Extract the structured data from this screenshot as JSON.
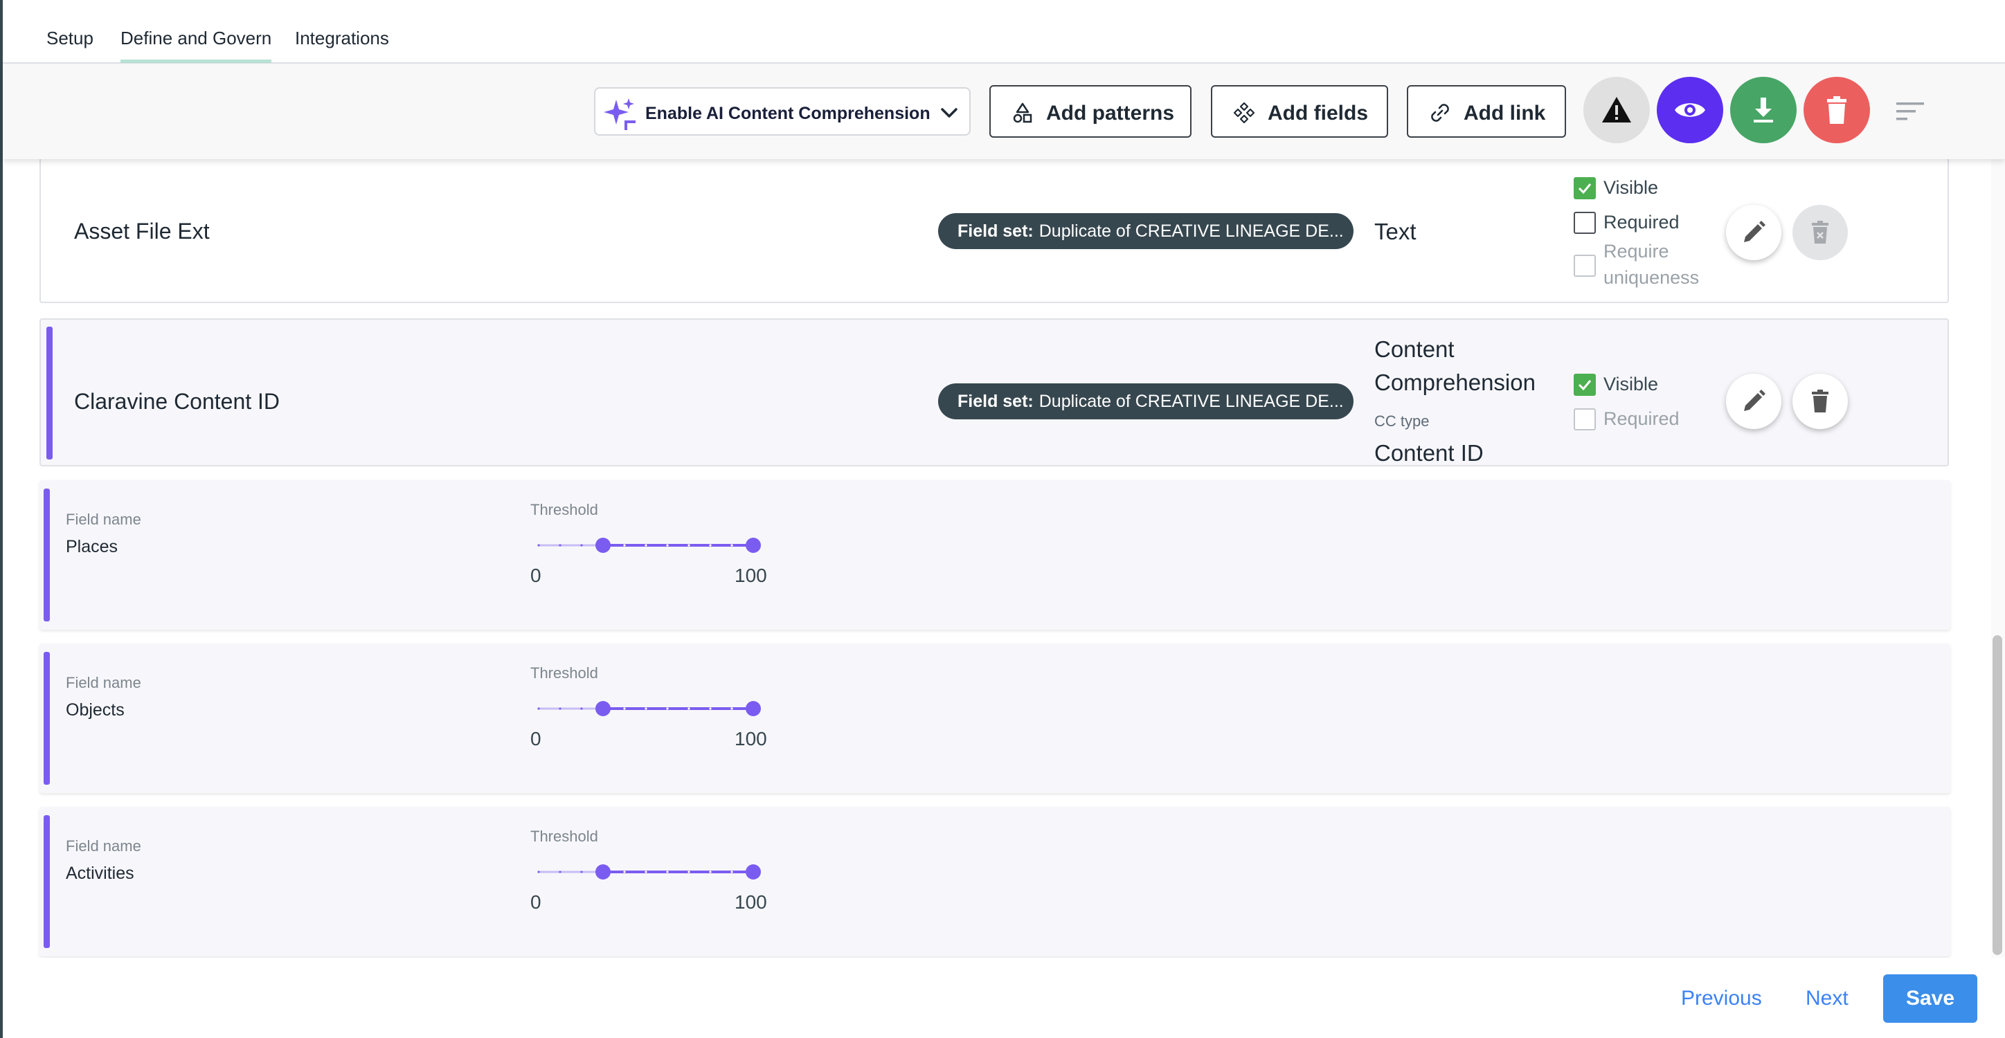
{
  "tabs": [
    {
      "label": "Setup",
      "active": false
    },
    {
      "label": "Define and Govern",
      "active": true
    },
    {
      "label": "Integrations",
      "active": false
    }
  ],
  "toolbar": {
    "ai_select_label": "Enable AI Content Comprehension",
    "add_patterns_label": "Add patterns",
    "add_fields_label": "Add fields",
    "add_link_label": "Add link",
    "action_buttons": [
      {
        "name": "warning",
        "color": "#e0e0e0"
      },
      {
        "name": "preview",
        "color": "#5b2ef0"
      },
      {
        "name": "download",
        "color": "#47a566"
      },
      {
        "name": "delete",
        "color": "#ec5f5f"
      }
    ],
    "accent_color": "#7b5cf0"
  },
  "fields": [
    {
      "name": "Asset File Ext",
      "field_set_prefix": "Field set:",
      "field_set_value": "Duplicate of CREATIVE LINEAGE DE...",
      "type": "Text",
      "visible_label": "Visible",
      "visible_checked": true,
      "required_label": "Required",
      "required_checked": false,
      "uniqueness_label_line1": "Require",
      "uniqueness_label_line2": "uniqueness",
      "uniqueness_checked": false
    },
    {
      "name": "Claravine Content ID",
      "field_set_prefix": "Field set:",
      "field_set_value": "Duplicate of CREATIVE LINEAGE DE...",
      "type_line1": "Content",
      "type_line2": "Comprehension",
      "cc_type_label": "CC type",
      "cc_type_value": "Content ID",
      "visible_label": "Visible",
      "visible_checked": true,
      "required_label": "Required",
      "required_checked": false
    }
  ],
  "sub_fields": [
    {
      "field_name_label": "Field name",
      "field_name": "Places",
      "threshold_label": "Threshold",
      "min": "0",
      "max": "100",
      "low": 30,
      "high": 100
    },
    {
      "field_name_label": "Field name",
      "field_name": "Objects",
      "threshold_label": "Threshold",
      "min": "0",
      "max": "100",
      "low": 30,
      "high": 100
    },
    {
      "field_name_label": "Field name",
      "field_name": "Activities",
      "threshold_label": "Threshold",
      "min": "0",
      "max": "100",
      "low": 30,
      "high": 100
    }
  ],
  "footer": {
    "previous_label": "Previous",
    "next_label": "Next",
    "save_label": "Save"
  }
}
